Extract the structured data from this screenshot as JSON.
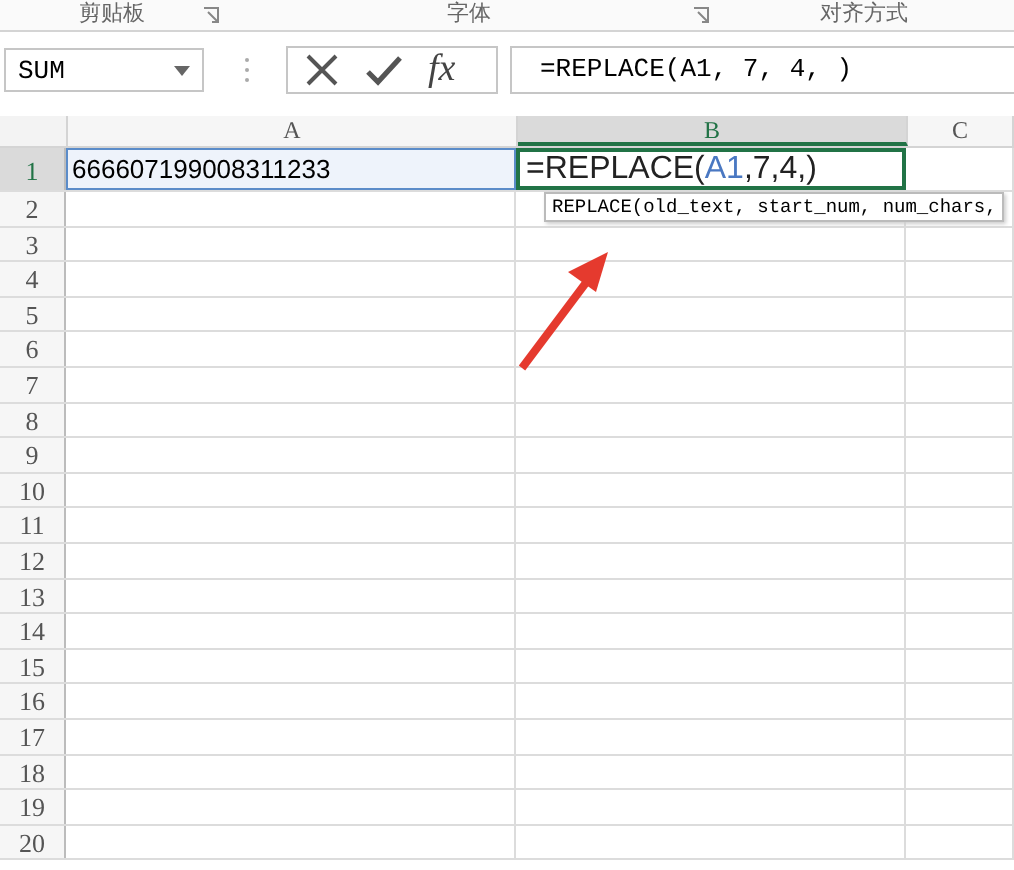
{
  "ribbon_groups": [
    {
      "label": "剪贴板",
      "launcher": true
    },
    {
      "label": "字体",
      "launcher": true
    },
    {
      "label": "对齐方式",
      "launcher": false
    }
  ],
  "name_box": {
    "value": "SUM"
  },
  "formula_bar": {
    "fx": "fx",
    "value": "=REPLACE(A1, 7, 4, )"
  },
  "columns": [
    {
      "label": "A",
      "selected": false
    },
    {
      "label": "B",
      "selected": true
    },
    {
      "label": "C",
      "selected": false
    }
  ],
  "rows": [
    {
      "label": "1",
      "selected": true
    },
    {
      "label": "2",
      "selected": false
    },
    {
      "label": "3",
      "selected": false
    },
    {
      "label": "4",
      "selected": false
    },
    {
      "label": "5",
      "selected": false
    },
    {
      "label": "6",
      "selected": false
    },
    {
      "label": "7",
      "selected": false
    },
    {
      "label": "8",
      "selected": false
    },
    {
      "label": "9",
      "selected": false
    },
    {
      "label": "10",
      "selected": false
    },
    {
      "label": "11",
      "selected": false
    },
    {
      "label": "12",
      "selected": false
    },
    {
      "label": "13",
      "selected": false
    },
    {
      "label": "14",
      "selected": false
    },
    {
      "label": "15",
      "selected": false
    },
    {
      "label": "16",
      "selected": false
    },
    {
      "label": "17",
      "selected": false
    },
    {
      "label": "18",
      "selected": false
    },
    {
      "label": "19",
      "selected": false
    },
    {
      "label": "20",
      "selected": false
    }
  ],
  "cell_a1": {
    "value": "666607199008311233",
    "referenced": true
  },
  "cell_b1": {
    "parts": [
      {
        "text": "=REPLACE(",
        "kind": "plain"
      },
      {
        "text": "A1",
        "kind": "ref"
      },
      {
        "text": ",7,4,)",
        "kind": "plain"
      }
    ]
  },
  "tooltip": "REPLACE(old_text, start_num, num_chars,"
}
